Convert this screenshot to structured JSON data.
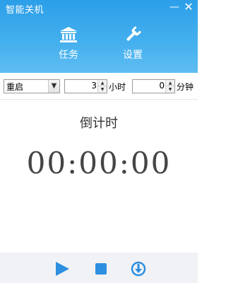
{
  "window": {
    "title": "智能关机",
    "minimize_glyph": "—",
    "close_glyph": "✕"
  },
  "nav": {
    "tasks": {
      "label": "任务",
      "icon": "bank-icon"
    },
    "settings": {
      "label": "设置",
      "icon": "wrench-icon"
    }
  },
  "controls": {
    "action_select": {
      "value": "重启"
    },
    "hours": {
      "value": "3",
      "unit": "小时"
    },
    "minutes": {
      "value": "0",
      "unit": "分钟"
    }
  },
  "countdown": {
    "label": "倒计时",
    "time": "00:00:00"
  },
  "bottom_bar": {
    "buttons": [
      "play-icon",
      "stop-icon",
      "download-icon"
    ]
  },
  "colors": {
    "header": "#3aa8ec",
    "accent": "#2d8fe0",
    "bottom_bar": "#f0f2f5"
  }
}
